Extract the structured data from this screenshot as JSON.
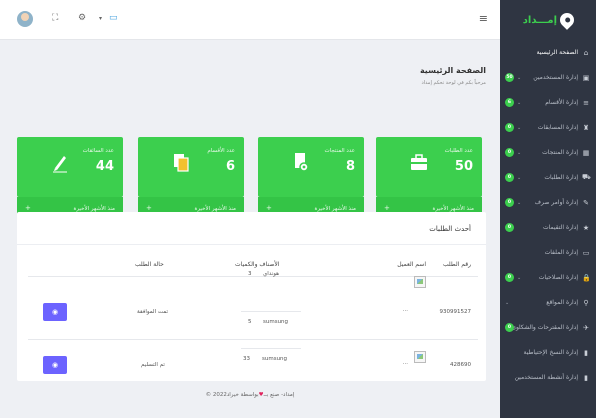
{
  "sidebar": {
    "logo_text": "إمـــداد",
    "items": [
      {
        "label": "الصفحة الرئيسية",
        "icon": "⌂",
        "icon_name": "home-icon",
        "badge": "",
        "chevron": false,
        "active": true
      },
      {
        "label": "إدارة المستخدمين",
        "icon": "▣",
        "icon_name": "users-icon",
        "badge": "50",
        "chevron": true
      },
      {
        "label": "إدارة الأقسام",
        "icon": "≡",
        "icon_name": "list-icon",
        "badge": "6",
        "chevron": true
      },
      {
        "label": "إدارة المسابقات",
        "icon": "♜",
        "icon_name": "trophy-icon",
        "badge": "0",
        "chevron": true
      },
      {
        "label": "إدارة المنتجات",
        "icon": "▦",
        "icon_name": "shop-icon",
        "badge": "0",
        "chevron": true
      },
      {
        "label": "إدارة الطلبات",
        "icon": "⛟",
        "icon_name": "cart-icon",
        "badge": "0",
        "chevron": true
      },
      {
        "label": "إدارة أوامر صرف",
        "icon": "✎",
        "icon_name": "edit-icon",
        "badge": "0",
        "chevron": true
      },
      {
        "label": "إدارة التقيمات",
        "icon": "★",
        "icon_name": "star-icon",
        "badge": "0",
        "chevron": false
      },
      {
        "label": "إدارة الملفات",
        "icon": "▭",
        "icon_name": "folder-icon",
        "badge": "",
        "chevron": false
      },
      {
        "label": "إدارة الصلاحيات",
        "icon": "🔒",
        "icon_name": "lock-icon",
        "badge": "0",
        "chevron": true
      },
      {
        "label": "إدارة المواقع",
        "icon": "⚲",
        "icon_name": "location-icon",
        "badge": "",
        "chevron": true
      },
      {
        "label": "إدارة المقترحات والشكاوى",
        "icon": "✈",
        "icon_name": "send-icon",
        "badge": "0",
        "chevron": true
      },
      {
        "label": "إدارة النسخ الإحتياطية",
        "icon": "▮",
        "icon_name": "backup-icon",
        "badge": "",
        "chevron": false
      },
      {
        "label": "إدارة أنشطة المستخدمين",
        "icon": "▮",
        "icon_name": "activity-icon",
        "badge": "",
        "chevron": false
      }
    ]
  },
  "topbar": {
    "menu_icon": "≡",
    "icons": [
      "⛶",
      "⚙",
      "▾",
      "▭"
    ]
  },
  "header": {
    "title": "الصفحة الرئيسية",
    "subtitle": "مرحباً بكم في لوحة تحكم إمداد"
  },
  "cards": [
    {
      "title": "عدد الطلبات",
      "value": "50",
      "foot": "منذ الأشهر الأخيرة",
      "arrow": "+",
      "icon_name": "briefcase-icon"
    },
    {
      "title": "عدد المنتجات",
      "value": "8",
      "foot": "منذ الأشهر الأخيرة",
      "arrow": "+",
      "icon_name": "document-icon"
    },
    {
      "title": "عدد الأقسام",
      "value": "6",
      "foot": "منذ الأشهر الأخيرة",
      "arrow": "+",
      "icon_name": "copy-icon"
    },
    {
      "title": "عدد السائقات",
      "value": "44",
      "foot": "منذ الأشهر الأخيرة",
      "arrow": "+",
      "icon_name": "pen-icon"
    }
  ],
  "orders": {
    "title": "أحدث الطلبات",
    "columns": {
      "number": "رقم الطلب",
      "customer": "اسم العميل",
      "items": "الأصناف والكميات",
      "status": "حالة الطلب"
    },
    "rows": [
      {
        "number": "930991527",
        "customer": "...",
        "items": [
          {
            "qty": "3",
            "name": "هونداي"
          },
          {
            "qty": "5",
            "name": "sumsung"
          }
        ],
        "status": "تمت الموافقة",
        "view": "◉"
      },
      {
        "number": "428690",
        "customer": "...",
        "items": [
          {
            "qty": "33",
            "name": "sumsung"
          }
        ],
        "status": "تم التسليم",
        "view": "◉"
      }
    ]
  },
  "footer": {
    "before": "© 2022إمداد- صنع بــ",
    "heart": "♥",
    "after": "بواسطة خيراد"
  },
  "colors": {
    "accent": "#3ccf4e",
    "sidebar": "#2f3542",
    "button": "#6c63ff"
  }
}
